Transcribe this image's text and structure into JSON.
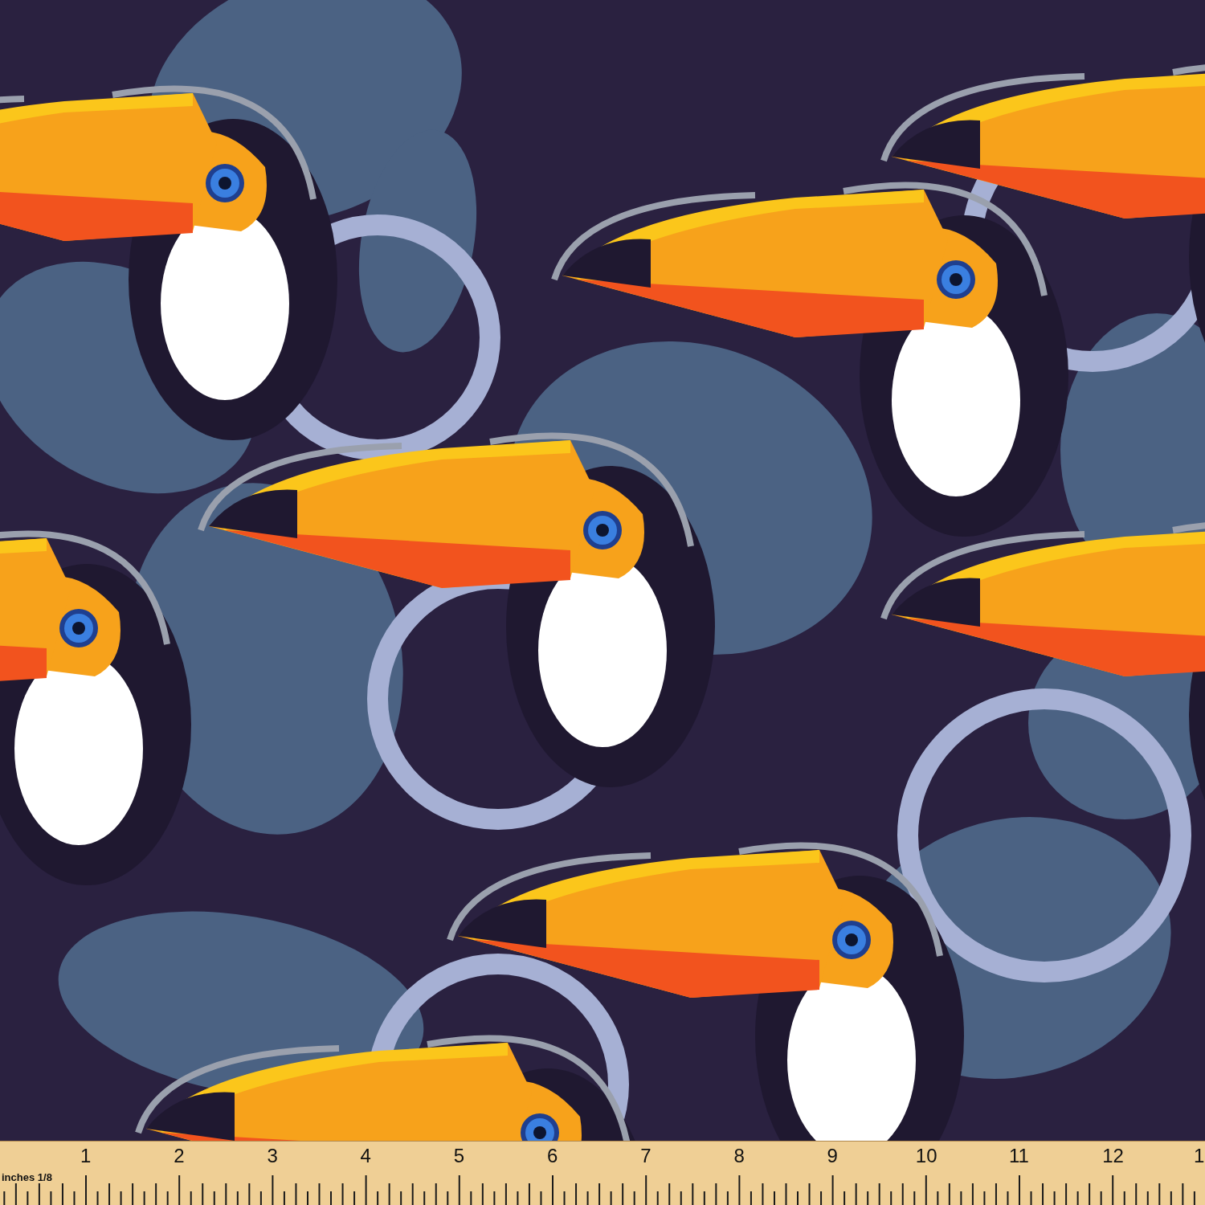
{
  "ruler": {
    "unit_label": "inches 1/8",
    "numbers": [
      "1",
      "2",
      "3",
      "4",
      "5",
      "6",
      "7",
      "8",
      "9",
      "10",
      "11",
      "12",
      "1"
    ]
  }
}
